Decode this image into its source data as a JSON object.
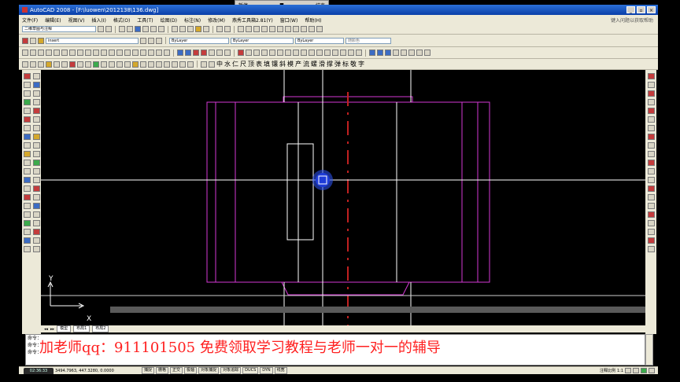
{
  "recorder": {
    "labels": [
      "暂停",
      "结束"
    ]
  },
  "window": {
    "title": "AutoCAD 2008 - [F:\\luowen\\2012138\\136.dwg]"
  },
  "menu": {
    "items": [
      "文件(F)",
      "编辑(E)",
      "视图(V)",
      "插入(I)",
      "格式(O)",
      "工具(T)",
      "绘图(D)",
      "标注(N)",
      "修改(M)",
      "燕秀工具箱2.81(Y)",
      "窗口(W)",
      "帮助(H)"
    ],
    "help_placeholder": "键入问题以获取帮助"
  },
  "toolbar1": {
    "workspace": "二维草图与注释"
  },
  "toolbar2": {
    "layer": "insert",
    "color": "ByLayer",
    "linetype": "ByLayer",
    "lineweight": "ByLayer",
    "plotstyle": "随颜色"
  },
  "toolbar4": {
    "glyphs": [
      "中",
      "水",
      "仁",
      "尺",
      "顶",
      "表",
      "填",
      "镶",
      "斜",
      "模",
      "产",
      "流",
      "螺",
      "滑",
      "撑",
      "弹",
      "标",
      "敬",
      "字"
    ]
  },
  "canvas": {
    "ucs_x": "X",
    "ucs_y": "Y"
  },
  "tabs": {
    "items": [
      "模型",
      "布局1",
      "布局2"
    ]
  },
  "command": {
    "lines": [
      "命令：",
      "命令：",
      "命令："
    ]
  },
  "watermark": {
    "text": "加老师qq：911101505 免费领取学习教程与老师一对一的辅导"
  },
  "status": {
    "coords": "3494.7963, 447.3280, 0.0000",
    "toggles": [
      "捕捉",
      "栅格",
      "正交",
      "极轴",
      "对象捕捉",
      "对象追踪",
      "DUCS",
      "DYN",
      "线宽"
    ],
    "annotation_scale_label": "注释比例",
    "annotation_scale": "1:1",
    "time": "02:36:33"
  },
  "colors": {
    "geometry": "#d438d4",
    "crosshair": "#ffffff",
    "centerline": "#c02020",
    "cursor": "#2a4fe8"
  }
}
